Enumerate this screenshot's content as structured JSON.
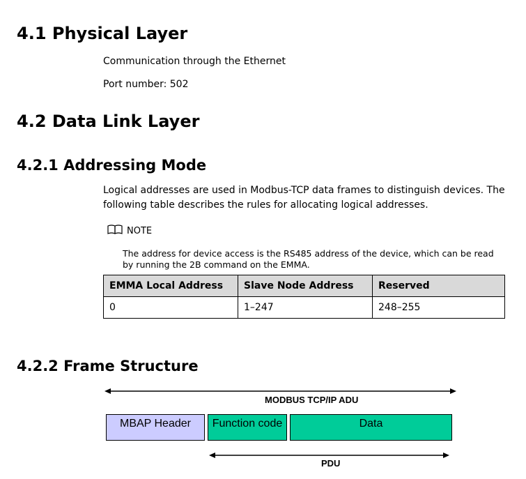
{
  "sections": {
    "physical": {
      "heading": "4.1 Physical Layer",
      "lines": [
        "Communication through the Ethernet",
        "Port number: 502"
      ]
    },
    "datalink": {
      "heading": "4.2 Data Link Layer"
    },
    "addressing": {
      "heading": "4.2.1 Addressing Mode",
      "paragraph_line1": "Logical addresses are used in Modbus-TCP data frames to distinguish devices. The",
      "paragraph_line2": "following table describes the rules for allocating logical addresses.",
      "note_label": "NOTE",
      "note_text": "The address for device access is the RS485 address of the device, which can be read by running the 2B command on the EMMA.",
      "table": {
        "headers": [
          "EMMA Local Address",
          "Slave Node Address",
          "Reserved"
        ],
        "rows": [
          [
            "0",
            "1–247",
            "248–255"
          ]
        ]
      }
    },
    "frame": {
      "heading": "4.2.2 Frame Structure",
      "adu_label": "MODBUS TCP/IP ADU",
      "pdu_label": "PDU",
      "boxes": [
        {
          "label": "MBAP Header",
          "color": "#ccccff"
        },
        {
          "label": "Function code",
          "color": "#00cc99"
        },
        {
          "label": "Data",
          "color": "#00cc99"
        }
      ]
    }
  }
}
